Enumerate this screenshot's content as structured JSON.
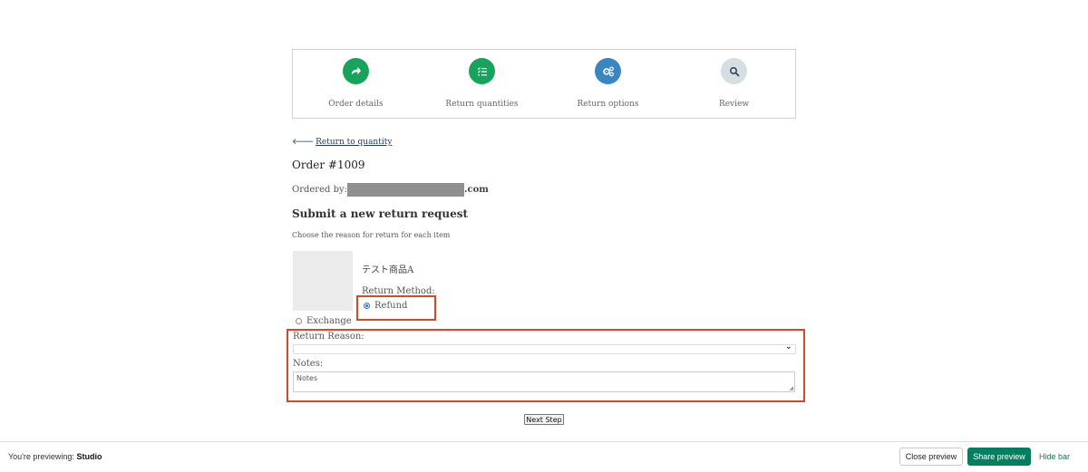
{
  "steps": [
    {
      "label": "Order details",
      "icon": "share-arrow-icon",
      "color": "#17a35b"
    },
    {
      "label": "Return quantities",
      "icon": "checklist-icon",
      "color": "#17a35b"
    },
    {
      "label": "Return options",
      "icon": "gears-icon",
      "color": "#3b86c0"
    },
    {
      "label": "Review",
      "icon": "search-icon",
      "color": "#d6dde3"
    }
  ],
  "back_link": "Return to quantity",
  "order": {
    "title": "Order #1009",
    "ordered_by_label": "Ordered by:",
    "email_suffix": ".com"
  },
  "form": {
    "title": "Submit a new return request",
    "instruction": "Choose the reason for return for each item",
    "product_name": "テスト商品A",
    "return_method_label": "Return Method:",
    "refund_label": "Refund",
    "refund_checked": true,
    "exchange_label": "Exchange",
    "return_reason_label": "Return Reason:",
    "return_reason_value": "",
    "notes_label": "Notes:",
    "notes_placeholder": "Notes",
    "next_button": "Next Step"
  },
  "preview_bar": {
    "previewing_text": "You're previewing:",
    "theme_name": "Studio",
    "close_button": "Close preview",
    "share_button": "Share preview",
    "hide_link": "Hide bar"
  },
  "colors": {
    "highlight": "#d9472b",
    "share_button": "#008060"
  }
}
